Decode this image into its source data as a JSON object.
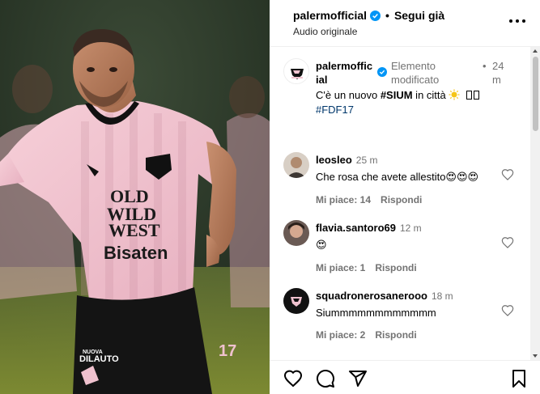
{
  "header": {
    "username": "palermofficial",
    "separator": "•",
    "follow_label": "Segui già",
    "audio_label": "Audio originale"
  },
  "caption": {
    "username_line1": "palermoffic",
    "username_line2": "ial",
    "edited_line1": "Elemento",
    "edited_line2": "modificato",
    "time_bullet": "•",
    "time_line1": "24",
    "time_line2": "m",
    "text_prefix": "C'è un nuovo ",
    "hashtag_sium": "#SIUM",
    "text_suffix": " in città ",
    "hashtag_fdf": "#FDF17"
  },
  "comments": [
    {
      "username": "leosleo",
      "time": "25 m",
      "text": "Che rosa che avete allestito😍😍😍",
      "likes": "Mi piace: 14",
      "reply": "Rispondi"
    },
    {
      "username": "flavia.santoro69",
      "time": "12 m",
      "text": "😍",
      "likes": "Mi piace: 1",
      "reply": "Rispondi"
    },
    {
      "username": "squadronerosanerooo",
      "time": "18 m",
      "text": "Siummmmmmmmmmmm",
      "likes": "Mi piace: 2",
      "reply": "Rispondi"
    }
  ],
  "media": {
    "jersey_text_1": "OLD",
    "jersey_text_2": "WILD",
    "jersey_text_3": "WEST",
    "sponsor": "Bisaten",
    "shorts_text": "NUOVA",
    "shorts_text2": "DILAUTO",
    "number": "17"
  },
  "actions": {
    "like": "heart-icon",
    "comment": "comment-icon",
    "share": "share-icon",
    "save": "bookmark-icon"
  },
  "colors": {
    "verified": "#0095f6",
    "hashtag": "#00376b",
    "jersey_pink": "#f0c2cf",
    "secondary_text": "#737373"
  }
}
